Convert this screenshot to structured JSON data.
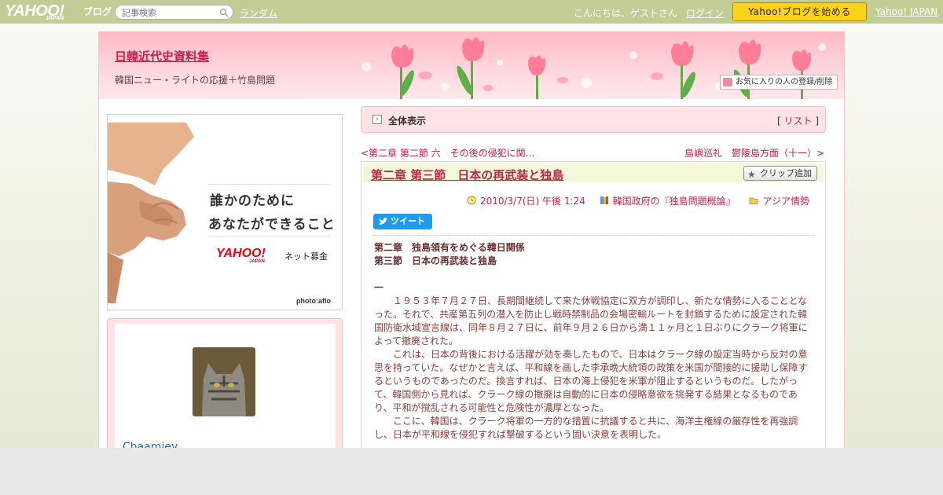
{
  "topbar": {
    "logo_text": "YAHOO!",
    "logo_sub": "JAPAN",
    "blog_text": "ブログ",
    "search_placeholder": "記事検索",
    "random_label": "ランダム",
    "greeting": "こんにちは、ゲストさん",
    "login_label": "ログイン",
    "start_button": "Yahoo!ブログを始める",
    "yahoo_japan_link": "Yahoo! JAPAN"
  },
  "banner": {
    "blog_title": "日韓近代史資料集",
    "blog_description": "韓国ニュー・ライトの応援＋竹島問題",
    "favorite_button": "お気に入りの人の登録/削除"
  },
  "ad": {
    "copy_line1": "誰かのために",
    "copy_line2": "あなたができること",
    "brand": "YAHOO!",
    "brand_sub": "JAPAN",
    "service": "ネット募金",
    "photo_credit": "photo:aflo"
  },
  "profile": {
    "username": "Chaamiey"
  },
  "list_bar": {
    "label": "全体表示",
    "list_open": "[",
    "list_link": "リスト",
    "list_close": "]"
  },
  "nav": {
    "prev": "<第二章 第二節 六　その後の侵犯に関...",
    "next": "島嶼巡礼　鬱陵島方面（十一）>"
  },
  "entry": {
    "title": "第二章 第三節　日本の再武装と独島",
    "clip_button": "クリップ追加",
    "date": "2010/3/7(日) 午後 1:24",
    "book_category": "韓国政府の『独島問題概論』",
    "folder_category": "アジア情勢",
    "tweet_button": "ツイート",
    "heading1": "第二章　独島領有をめぐる韓日関係",
    "heading2": "第三節　日本の再武装と独島",
    "section_mark": "一",
    "para1": "　　１９５３年７月２７日、長期間継続して来た休戦協定に双方が調印し、新たな情勢に入ることとなった。それで、共産第五列の潜入を防止し戦時禁制品の会場密輸ルートを封鎖するために設定された韓国防衛水域宣言線は、同年８月２７日に、前年９月２６日から満１１ヶ月と１日ぶりにクラーク将軍によって撤廃された。",
    "para2": "　　これは、日本の背後における活躍が効を奏したもので、日本はクラーク線の設定当時から反対の意思を持っていた。なぜかと言えば、平和線を画した李承晩大統領の政策を米国が間接的に援助し保障するというものであったのだ。換言すれば、日本の海上侵犯を米軍が阻止するというものだ。したがって、韓国側から見れば、クラーク線の撤廃は自動的に日本の侵略意欲を挑発する結果となるものであり、平和が撹乱される可能性と危険性が濃厚となった。",
    "para3": "　　ここに、韓国は、クラーク将軍の一方的な措置に抗議すると共に、海洋主権線の厳存性を再強調し、日本が平和線を侵犯すれば撃破するという固い決意を表明した。"
  },
  "colors": {
    "topbar": "#c4cc96",
    "link": "#c0234d",
    "start_button": "#ffd21a",
    "banner_pink": "#ffb9c4",
    "tweet_blue": "#1d9bf0"
  },
  "icons": [
    "search-icon",
    "heart-icon",
    "arrow-icon",
    "star-icon",
    "clock-icon",
    "book-icon",
    "folder-icon",
    "bird-icon"
  ]
}
